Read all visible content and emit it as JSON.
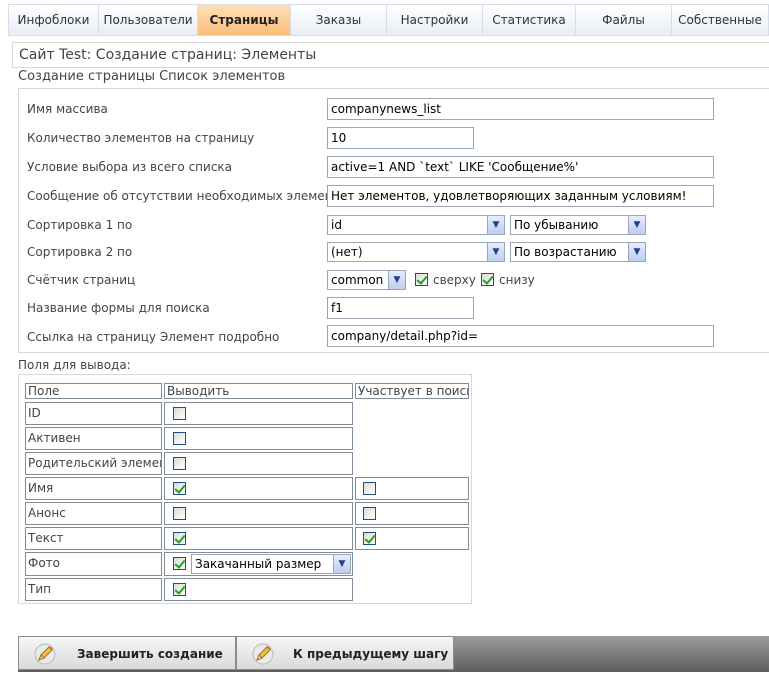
{
  "tabs": [
    {
      "label": "Инфоблоки",
      "active": false
    },
    {
      "label": "Пользователи",
      "active": false
    },
    {
      "label": "Страницы",
      "active": true
    },
    {
      "label": "Заказы",
      "active": false
    },
    {
      "label": "Настройки",
      "active": false
    },
    {
      "label": "Статистика",
      "active": false
    },
    {
      "label": "Файлы",
      "active": false
    },
    {
      "label": "Собственные",
      "active": false
    }
  ],
  "page_title": "Сайт Test: Создание страниц: Элементы",
  "section_title": "Создание страницы Список элементов",
  "form": {
    "array_name_label": "Имя массива",
    "array_name_value": "companynews_list",
    "per_page_label": "Количество элементов на страницу",
    "per_page_value": "10",
    "condition_label": "Условие выбора из всего списка",
    "condition_value": "active=1 AND `text` LIKE 'Сообщение%'",
    "empty_msg_label": "Сообщение об отсутствии необходимых элементов",
    "empty_msg_value": "Нет элементов, удовлетворяющих заданным условиям!",
    "sort1_label": "Сортировка 1 по",
    "sort1_field": "id",
    "sort1_order": "По убыванию",
    "sort2_label": "Сортировка 2 по",
    "sort2_field": "(нет)",
    "sort2_order": "По возрастанию",
    "pager_label": "Счётчик страниц",
    "pager_value": "common",
    "pager_top_label": "сверху",
    "pager_top_checked": true,
    "pager_bottom_label": "снизу",
    "pager_bottom_checked": true,
    "search_form_label": "Название формы для поиска",
    "search_form_value": "f1",
    "detail_link_label": "Ссылка на страницу Элемент подробно",
    "detail_link_value": "company/detail.php?id="
  },
  "fields": {
    "section_label": "Поля для вывода:",
    "headers": [
      "Поле",
      "Выводить",
      "Участвует в поиске"
    ],
    "rows": [
      {
        "name": "ID",
        "show": false,
        "search": null
      },
      {
        "name": "Активен",
        "show": false,
        "search": null
      },
      {
        "name": "Родительский элемент",
        "show": false,
        "search": null
      },
      {
        "name": "Имя",
        "show": true,
        "search": false
      },
      {
        "name": "Анонс",
        "show": false,
        "search": false
      },
      {
        "name": "Текст",
        "show": true,
        "search": true
      },
      {
        "name": "Фото",
        "show": true,
        "search": null,
        "select": "Закачанный размер"
      },
      {
        "name": "Тип",
        "show": true,
        "search": null
      }
    ]
  },
  "buttons": {
    "finish": "Завершить создание",
    "back": "К предыдущему шагу"
  }
}
